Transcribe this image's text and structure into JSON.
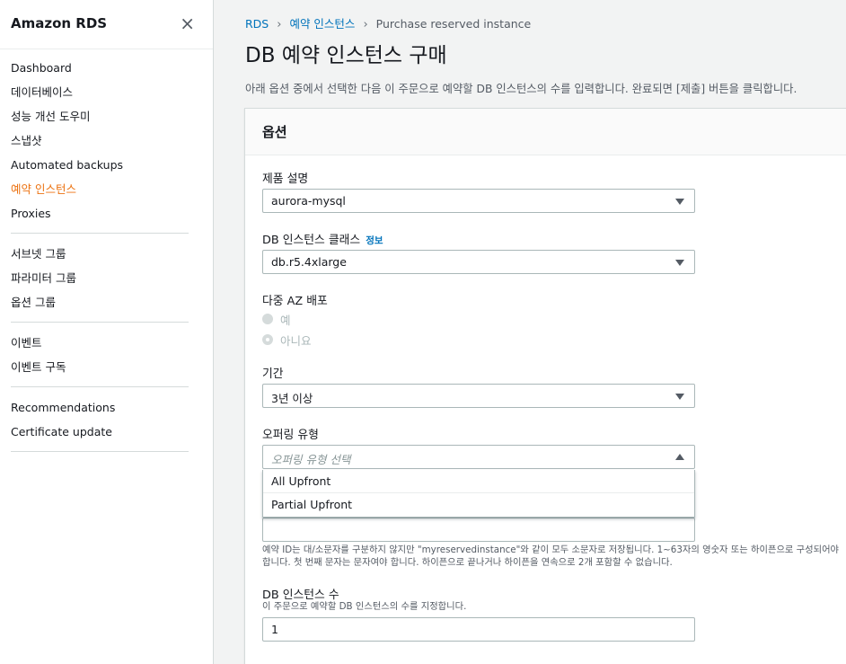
{
  "sidebar": {
    "title": "Amazon RDS",
    "close_icon": "×",
    "groups": [
      [
        {
          "label": "Dashboard",
          "active": false
        },
        {
          "label": "데이터베이스",
          "active": false
        },
        {
          "label": "성능 개선 도우미",
          "active": false
        },
        {
          "label": "스냅샷",
          "active": false
        },
        {
          "label": "Automated backups",
          "active": false
        },
        {
          "label": "예약 인스턴스",
          "active": true
        },
        {
          "label": "Proxies",
          "active": false
        }
      ],
      [
        {
          "label": "서브넷 그룹",
          "active": false
        },
        {
          "label": "파라미터 그룹",
          "active": false
        },
        {
          "label": "옵션 그룹",
          "active": false
        }
      ],
      [
        {
          "label": "이벤트",
          "active": false
        },
        {
          "label": "이벤트 구독",
          "active": false
        }
      ],
      [
        {
          "label": "Recommendations",
          "active": false
        },
        {
          "label": "Certificate update",
          "active": false
        }
      ]
    ]
  },
  "breadcrumb": {
    "items": [
      "RDS",
      "예약 인스턴스",
      "Purchase reserved instance"
    ],
    "separator": "›"
  },
  "page": {
    "title": "DB 예약 인스턴스 구매",
    "description": "아래 옵션 중에서 선택한 다음 이 주문으로 예약할 DB 인스턴스의 수를 입력합니다. 완료되면 [제출] 버튼을 클릭합니다."
  },
  "options_panel": {
    "title": "옵션",
    "product_description": {
      "label": "제품 설명",
      "value": "aurora-mysql"
    },
    "instance_class": {
      "label": "DB 인스턴스 클래스",
      "info_label": "정보",
      "value": "db.r5.4xlarge"
    },
    "multi_az": {
      "label": "다중 AZ 배포",
      "options": [
        "예",
        "아니요"
      ],
      "selected": "아니요"
    },
    "term": {
      "label": "기간",
      "value": "3년 이상"
    },
    "offering_type": {
      "label": "오퍼링 유형",
      "placeholder": "오퍼링 유형 선택",
      "open": true,
      "options": [
        "All Upfront",
        "Partial Upfront"
      ]
    },
    "reservation_id": {
      "value": "",
      "hint": "예약 ID는 대/소문자를 구분하지 않지만 \"myreservedinstance\"와 같이 모두 소문자로 저장됩니다. 1~63자의 영숫자 또는 하이픈으로 구성되어야 합니다. 첫 번째 문자는 문자여야 합니다. 하이픈으로 끝나거나 하이픈을 연속으로 2개 포함할 수 없습니다."
    },
    "instance_count": {
      "label": "DB 인스턴스 수",
      "hint": "이 주문으로 예약할 DB 인스턴스의 수를 지정합니다.",
      "value": "1"
    }
  },
  "colors": {
    "accent_active": "#ec7211",
    "link": "#0073bb",
    "border": "#aab7b8",
    "background": "#f2f3f3"
  }
}
